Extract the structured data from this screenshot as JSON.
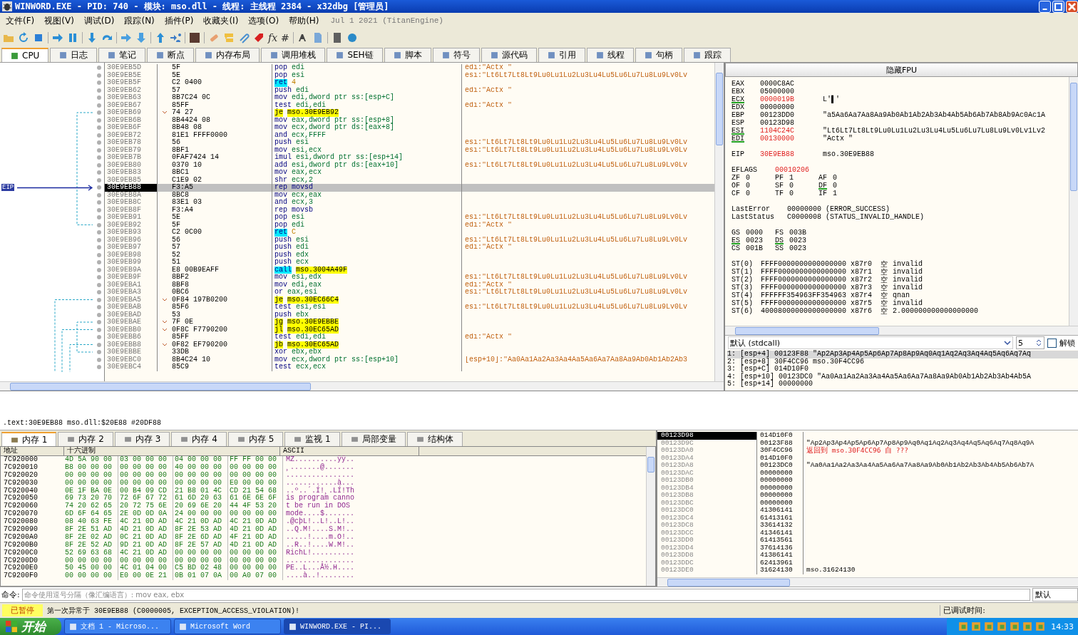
{
  "window": {
    "title": "WINWORD.EXE - PID: 740 - 模块: mso.dll - 线程: 主线程 2384 - x32dbg [管理员]"
  },
  "menu": [
    "文件(F)",
    "视图(V)",
    "调试(D)",
    "跟踪(N)",
    "插件(P)",
    "收藏夹(I)",
    "选项(O)",
    "帮助(H)"
  ],
  "build_info": "Jul 1 2021 (TitanEngine)",
  "toolbar": {
    "glyphs": [
      "fx",
      "#"
    ]
  },
  "tabs": [
    {
      "label": "CPU",
      "selected": true
    },
    {
      "label": "日志",
      "selected": false
    },
    {
      "label": "笔记",
      "selected": false
    },
    {
      "label": "断点",
      "selected": false
    },
    {
      "label": "内存布局",
      "selected": false
    },
    {
      "label": "调用堆栈",
      "selected": false
    },
    {
      "label": "SEH链",
      "selected": false
    },
    {
      "label": "脚本",
      "selected": false
    },
    {
      "label": "符号",
      "selected": false
    },
    {
      "label": "源代码",
      "selected": false
    },
    {
      "label": "引用",
      "selected": false
    },
    {
      "label": "线程",
      "selected": false
    },
    {
      "label": "句柄",
      "selected": false
    },
    {
      "label": "跟踪",
      "selected": false
    }
  ],
  "disassembly": {
    "eip_label": "EIP",
    "rows": [
      {
        "address": "30E9EB5D",
        "bytes": "5F",
        "branch": false,
        "mnemonic": "pop",
        "operands": "edi",
        "kind": "plain",
        "comment": "edi:\"Actx \"",
        "selected": false
      },
      {
        "address": "30E9EB5E",
        "bytes": "5E",
        "branch": false,
        "mnemonic": "pop",
        "operands": "esi",
        "kind": "plain",
        "comment": "esi:\"Lt6Lt7Lt8Lt9Lu0Lu1Lu2Lu3Lu4Lu5Lu6Lu7Lu8Lu9Lv0Lv",
        "selected": false
      },
      {
        "address": "30E9EB5F",
        "bytes": "C2 0400",
        "branch": false,
        "mnemonic": "ret",
        "operands": "4",
        "kind": "ret",
        "selected": false
      },
      {
        "address": "30E9EB62",
        "bytes": "57",
        "branch": false,
        "mnemonic": "push",
        "operands": "edi",
        "kind": "plain",
        "comment": "edi:\"Actx \"",
        "selected": false
      },
      {
        "address": "30E9EB63",
        "bytes": "8B7C24 0C",
        "branch": false,
        "mnemonic": "mov",
        "operands": "edi,dword ptr ss:[esp+C]",
        "kind": "plain",
        "selected": false
      },
      {
        "address": "30E9EB67",
        "bytes": "85FF",
        "branch": false,
        "mnemonic": "test",
        "operands": "edi,edi",
        "kind": "plain",
        "comment": "edi:\"Actx \"",
        "selected": false
      },
      {
        "address": "30E9EB69",
        "bytes": "74 27",
        "branch": true,
        "mnemonic": "je",
        "operands": "mso.30E9EB92",
        "kind": "jump",
        "selected": false
      },
      {
        "address": "30E9EB6B",
        "bytes": "8B4424 08",
        "branch": false,
        "mnemonic": "mov",
        "operands": "eax,dword ptr ss:[esp+8]",
        "kind": "plain",
        "selected": false
      },
      {
        "address": "30E9EB6F",
        "bytes": "8B48 08",
        "branch": false,
        "mnemonic": "mov",
        "operands": "ecx,dword ptr ds:[eax+8]",
        "kind": "plain",
        "selected": false
      },
      {
        "address": "30E9EB72",
        "bytes": "81E1 FFFF0000",
        "branch": false,
        "mnemonic": "and",
        "operands": "ecx,FFFF",
        "kind": "plain",
        "selected": false
      },
      {
        "address": "30E9EB78",
        "bytes": "56",
        "branch": false,
        "mnemonic": "push",
        "operands": "esi",
        "kind": "plain",
        "comment": "esi:\"Lt6Lt7Lt8Lt9Lu0Lu1Lu2Lu3Lu4Lu5Lu6Lu7Lu8Lu9Lv0Lv",
        "selected": false
      },
      {
        "address": "30E9EB79",
        "bytes": "8BF1",
        "branch": false,
        "mnemonic": "mov",
        "operands": "esi,ecx",
        "kind": "plain",
        "comment": "esi:\"Lt6Lt7Lt8Lt9Lu0Lu1Lu2Lu3Lu4Lu5Lu6Lu7Lu8Lu9Lv0Lv",
        "selected": false
      },
      {
        "address": "30E9EB7B",
        "bytes": "0FAF7424 14",
        "branch": false,
        "mnemonic": "imul",
        "operands": "esi,dword ptr ss:[esp+14]",
        "kind": "plain",
        "selected": false
      },
      {
        "address": "30E9EB80",
        "bytes": "0370 10",
        "branch": false,
        "mnemonic": "add",
        "operands": "esi,dword ptr ds:[eax+10]",
        "kind": "plain",
        "comment": "esi:\"Lt6Lt7Lt8Lt9Lu0Lu1Lu2Lu3Lu4Lu5Lu6Lu7Lu8Lu9Lv0Lv",
        "selected": false
      },
      {
        "address": "30E9EB83",
        "bytes": "8BC1",
        "branch": false,
        "mnemonic": "mov",
        "operands": "eax,ecx",
        "kind": "plain",
        "selected": false
      },
      {
        "address": "30E9EB85",
        "bytes": "C1E9 02",
        "branch": false,
        "mnemonic": "shr",
        "operands": "ecx,2",
        "kind": "plain",
        "selected": false
      },
      {
        "address": "30E9EB88",
        "bytes": "F3:A5",
        "branch": false,
        "mnemonic": "rep movsd",
        "kind": "plain",
        "selected": true
      },
      {
        "address": "30E9EB8A",
        "bytes": "8BC8",
        "branch": false,
        "mnemonic": "mov",
        "operands": "ecx,eax",
        "kind": "plain",
        "selected": false
      },
      {
        "address": "30E9EB8C",
        "bytes": "83E1 03",
        "branch": false,
        "mnemonic": "and",
        "operands": "ecx,3",
        "kind": "plain",
        "selected": false
      },
      {
        "address": "30E9EB8F",
        "bytes": "F3:A4",
        "branch": false,
        "mnemonic": "rep movsb",
        "kind": "plain",
        "selected": false
      },
      {
        "address": "30E9EB91",
        "bytes": "5E",
        "branch": false,
        "mnemonic": "pop",
        "operands": "esi",
        "kind": "plain",
        "comment": "esi:\"Lt6Lt7Lt8Lt9Lu0Lu1Lu2Lu3Lu4Lu5Lu6Lu7Lu8Lu9Lv0Lv",
        "selected": false
      },
      {
        "address": "30E9EB92",
        "bytes": "5F",
        "branch": false,
        "mnemonic": "pop",
        "operands": "edi",
        "kind": "plain",
        "comment": "edi:\"Actx \"",
        "selected": false
      },
      {
        "address": "30E9EB93",
        "bytes": "C2 0C00",
        "branch": false,
        "mnemonic": "ret",
        "operands": "C",
        "kind": "ret",
        "selected": false
      },
      {
        "address": "30E9EB96",
        "bytes": "56",
        "branch": false,
        "mnemonic": "push",
        "operands": "esi",
        "kind": "plain",
        "comment": "esi:\"Lt6Lt7Lt8Lt9Lu0Lu1Lu2Lu3Lu4Lu5Lu6Lu7Lu8Lu9Lv0Lv",
        "selected": false
      },
      {
        "address": "30E9EB97",
        "bytes": "57",
        "branch": false,
        "mnemonic": "push",
        "operands": "edi",
        "kind": "plain",
        "comment": "edi:\"Actx \"",
        "selected": false
      },
      {
        "address": "30E9EB98",
        "bytes": "52",
        "branch": false,
        "mnemonic": "push",
        "operands": "edx",
        "kind": "plain",
        "selected": false
      },
      {
        "address": "30E9EB99",
        "bytes": "51",
        "branch": false,
        "mnemonic": "push",
        "operands": "ecx",
        "kind": "plain",
        "selected": false
      },
      {
        "address": "30E9EB9A",
        "bytes": "E8 00B9EAFF",
        "branch": false,
        "mnemonic": "call",
        "operands": "mso.3004A49F",
        "kind": "call",
        "selected": false
      },
      {
        "address": "30E9EB9F",
        "bytes": "8BF2",
        "branch": false,
        "mnemonic": "mov",
        "operands": "esi,edx",
        "kind": "plain",
        "comment": "esi:\"Lt6Lt7Lt8Lt9Lu0Lu1Lu2Lu3Lu4Lu5Lu6Lu7Lu8Lu9Lv0Lv",
        "selected": false
      },
      {
        "address": "30E9EBA1",
        "bytes": "8BF8",
        "branch": false,
        "mnemonic": "mov",
        "operands": "edi,eax",
        "kind": "plain",
        "comment": "edi:\"Actx \"",
        "selected": false
      },
      {
        "address": "30E9EBA3",
        "bytes": "0BC6",
        "branch": false,
        "mnemonic": "or",
        "operands": "eax,esi",
        "kind": "plain",
        "comment": "esi:\"Lt6Lt7Lt8Lt9Lu0Lu1Lu2Lu3Lu4Lu5Lu6Lu7Lu8Lu9Lv0Lv",
        "selected": false
      },
      {
        "address": "30E9EBA5",
        "bytes": "0F84 197B0200",
        "branch": true,
        "mnemonic": "je",
        "operands": "mso.30EC66C4",
        "kind": "jump",
        "selected": false
      },
      {
        "address": "30E9EBAB",
        "bytes": "85F6",
        "branch": false,
        "mnemonic": "test",
        "operands": "esi,esi",
        "kind": "plain",
        "comment": "esi:\"Lt6Lt7Lt8Lt9Lu0Lu1Lu2Lu3Lu4Lu5Lu6Lu7Lu8Lu9Lv0Lv",
        "selected": false
      },
      {
        "address": "30E9EBAD",
        "bytes": "53",
        "branch": false,
        "mnemonic": "push",
        "operands": "ebx",
        "kind": "plain",
        "selected": false
      },
      {
        "address": "30E9EBAE",
        "bytes": "7F 0E",
        "branch": true,
        "mnemonic": "jg",
        "operands": "mso.30E9EBBE",
        "kind": "jump",
        "selected": false
      },
      {
        "address": "30E9EBB0",
        "bytes": "0F8C F7790200",
        "branch": true,
        "mnemonic": "jl",
        "operands": "mso.30EC65AD",
        "kind": "jump",
        "selected": false
      },
      {
        "address": "30E9EBB6",
        "bytes": "85FF",
        "branch": false,
        "mnemonic": "test",
        "operands": "edi,edi",
        "kind": "plain",
        "comment": "edi:\"Actx \"",
        "selected": false
      },
      {
        "address": "30E9EBB8",
        "bytes": "0F82 EF790200",
        "branch": true,
        "mnemonic": "jb",
        "operands": "mso.30EC65AD",
        "kind": "jump",
        "selected": false
      },
      {
        "address": "30E9EBBE",
        "bytes": "33DB",
        "branch": false,
        "mnemonic": "xor",
        "operands": "ebx,ebx",
        "kind": "plain",
        "selected": false
      },
      {
        "address": "30E9EBC0",
        "bytes": "8B4C24 10",
        "branch": false,
        "mnemonic": "mov",
        "operands": "ecx,dword ptr ss:[esp+10]",
        "kind": "plain",
        "comment": "[esp+10]:\"Aa0Aa1Aa2Aa3Aa4Aa5Aa6Aa7Aa8Aa9Ab0Ab1Ab2Ab3",
        "selected": false
      },
      {
        "address": "30E9EBC4",
        "bytes": "85C9",
        "branch": false,
        "mnemonic": "test",
        "operands": "ecx,ecx",
        "kind": "plain",
        "selected": false
      }
    ]
  },
  "info_line": ".text:30E9EB88 mso.dll:$20E88 #20DF88",
  "registers_panel": {
    "toggle_button": "隐藏FPU",
    "gp_registers": [
      {
        "name": "EAX",
        "value": "0000C8AC",
        "changed": false,
        "marked": false
      },
      {
        "name": "EBX",
        "value": "05000000",
        "changed": false,
        "marked": false
      },
      {
        "name": "ECX",
        "value": "0000019B",
        "changed": true,
        "marked": true,
        "comment": "L'▌'"
      },
      {
        "name": "EDX",
        "value": "00000000",
        "changed": false,
        "marked": false
      },
      {
        "name": "EBP",
        "value": "00123DD0",
        "changed": false,
        "marked": false,
        "comment": "\"a5Aa6Aa7Aa8Aa9Ab0Ab1Ab2Ab3Ab4Ab5Ab6Ab7Ab8Ab9Ac0Ac1A"
      },
      {
        "name": "ESP",
        "value": "00123D98",
        "changed": false,
        "marked": false
      },
      {
        "name": "ESI",
        "value": "1104C24C",
        "changed": true,
        "marked": true,
        "comment": "\"Lt6Lt7Lt8Lt9Lu0Lu1Lu2Lu3Lu4Lu5Lu6Lu7Lu8Lu9Lv0Lv1Lv2"
      },
      {
        "name": "EDI",
        "value": "00130000",
        "changed": true,
        "marked": true,
        "comment": "\"Actx \""
      }
    ],
    "ip_register": {
      "name": "EIP",
      "value": "30E9EB88",
      "changed": true,
      "comment": "mso.30E9EB88"
    },
    "eflags": {
      "name": "EFLAGS",
      "value": "00010206",
      "changed": true
    },
    "flags": [
      {
        "name": "ZF",
        "value": "0",
        "marked": false
      },
      {
        "name": "PF",
        "value": "1",
        "marked": false
      },
      {
        "name": "AF",
        "value": "0",
        "marked": false
      },
      {
        "name": "OF",
        "value": "0",
        "marked": false
      },
      {
        "name": "SF",
        "value": "0",
        "marked": false
      },
      {
        "name": "DF",
        "value": "0",
        "marked": true
      },
      {
        "name": "CF",
        "value": "0",
        "marked": false
      },
      {
        "name": "TF",
        "value": "0",
        "marked": false
      },
      {
        "name": "IF",
        "value": "1",
        "marked": false
      }
    ],
    "last_status": [
      {
        "label": "LastError",
        "value": "00000000 (ERROR_SUCCESS)"
      },
      {
        "label": "LastStatus",
        "value": "C0000008 (STATUS_INVALID_HANDLE)"
      }
    ],
    "segments": [
      {
        "name": "GS",
        "value": "0000",
        "marked": false
      },
      {
        "name": "FS",
        "value": "003B",
        "marked": false
      },
      {
        "name": "ES",
        "value": "0023",
        "marked": true
      },
      {
        "name": "DS",
        "value": "0023",
        "marked": true
      },
      {
        "name": "CS",
        "value": "001B",
        "marked": false
      },
      {
        "name": "SS",
        "value": "0023",
        "marked": false
      }
    ],
    "fpu": [
      {
        "name": "ST(0)",
        "value": "FFFF0000000000000000",
        "register": "x87r0",
        "tag": "空",
        "description": "invalid"
      },
      {
        "name": "ST(1)",
        "value": "FFFF0000000000000000",
        "register": "x87r1",
        "tag": "空",
        "description": "invalid"
      },
      {
        "name": "ST(2)",
        "value": "FFFF0000000000000000",
        "register": "x87r2",
        "tag": "空",
        "description": "invalid"
      },
      {
        "name": "ST(3)",
        "value": "FFFF0000000000000000",
        "register": "x87r3",
        "tag": "空",
        "description": "invalid"
      },
      {
        "name": "ST(4)",
        "value": "FFFFFF354963FF354963",
        "register": "x87r4",
        "tag": "空",
        "description": "qnan"
      },
      {
        "name": "ST(5)",
        "value": "FFFF0000000000000000",
        "register": "x87r5",
        "tag": "空",
        "description": "invalid"
      },
      {
        "name": "ST(6)",
        "value": "40008000000000000000",
        "register": "x87r6",
        "tag": "空",
        "description": "2.000000000000000000"
      }
    ]
  },
  "call_args": {
    "convention": "默认 (stdcall)",
    "count": "5",
    "unlock": {
      "label": "解锁",
      "checked": false
    },
    "lines": [
      {
        "text": "1: [esp+4] 00123F88 \"Ap2Ap3Ap4Ap5Ap6Ap7Ap8Ap9Aq0Aq1Aq2Aq3Aq4Aq5Aq6Aq7Aq",
        "selected": true
      },
      {
        "text": "2: [esp+8] 30F4CC96 mso.30F4CC96",
        "selected": false
      },
      {
        "text": "3: [esp+C] 014D10F0",
        "selected": false
      },
      {
        "text": "4: [esp+10] 00123DC0 \"Aa0Aa1Aa2Aa3Aa4Aa5Aa6Aa7Aa8Aa9Ab0Ab1Ab2Ab3Ab4Ab5A",
        "selected": false
      },
      {
        "text": "5: [esp+14] 00000000",
        "selected": false
      }
    ]
  },
  "memory_tabs": [
    {
      "label": "内存 1",
      "selected": true
    },
    {
      "label": "内存 2",
      "selected": false
    },
    {
      "label": "内存 3",
      "selected": false
    },
    {
      "label": "内存 4",
      "selected": false
    },
    {
      "label": "内存 5",
      "selected": false
    },
    {
      "label": "监视 1",
      "selected": false
    },
    {
      "label": "局部变量",
      "selected": false
    },
    {
      "label": "结构体",
      "selected": false
    }
  ],
  "hex_dump": {
    "columns": [
      "地址",
      "十六进制",
      "ASCII"
    ],
    "rows": [
      {
        "address": "7C920000",
        "bytes": "4D 5A 90 00 03 00 00 00 04 00 00 00 FF FF 00 00",
        "ascii": "MZ..........ÿÿ.."
      },
      {
        "address": "7C920010",
        "bytes": "B8 00 00 00 00 00 00 00 40 00 00 00 00 00 00 00",
        "ascii": "¸.......@......."
      },
      {
        "address": "7C920020",
        "bytes": "00 00 00 00 00 00 00 00 00 00 00 00 00 00 00 00",
        "ascii": "................"
      },
      {
        "address": "7C920030",
        "bytes": "00 00 00 00 00 00 00 00 00 00 00 00 E0 00 00 00",
        "ascii": "............à..."
      },
      {
        "address": "7C920040",
        "bytes": "0E 1F BA 0E 00 B4 09 CD 21 B8 01 4C CD 21 54 68",
        "ascii": "..º..´.Í!¸.LÍ!Th"
      },
      {
        "address": "7C920050",
        "bytes": "69 73 20 70 72 6F 67 72 61 6D 20 63 61 6E 6E 6F",
        "ascii": "is program canno"
      },
      {
        "address": "7C920060",
        "bytes": "74 20 62 65 20 72 75 6E 20 69 6E 20 44 4F 53 20",
        "ascii": "t be run in DOS "
      },
      {
        "address": "7C920070",
        "bytes": "6D 6F 64 65 2E 0D 0D 0A 24 00 00 00 00 00 00 00",
        "ascii": "mode....$......."
      },
      {
        "address": "7C920080",
        "bytes": "08 40 63 FE 4C 21 0D AD 4C 21 0D AD 4C 21 0D AD",
        "ascii": ".@cþL!..L!..L!.."
      },
      {
        "address": "7C920090",
        "bytes": "8F 2E 51 AD 4D 21 0D AD 8F 2E 53 AD 4D 21 0D AD",
        "ascii": "..Q.M!....S.M!.."
      },
      {
        "address": "7C9200A0",
        "bytes": "8F 2E 02 AD 0C 21 0D AD 8F 2E 6D AD 4F 21 0D AD",
        "ascii": ".....!....m.O!.."
      },
      {
        "address": "7C9200B0",
        "bytes": "8F 2E 52 AD 9D 21 0D AD 8F 2E 57 AD 4D 21 0D AD",
        "ascii": "..R..!....W.M!.."
      },
      {
        "address": "7C9200C0",
        "bytes": "52 69 63 68 4C 21 0D AD 00 00 00 00 00 00 00 00",
        "ascii": "RichL!.........."
      },
      {
        "address": "7C9200D0",
        "bytes": "00 00 00 00 00 00 00 00 00 00 00 00 00 00 00 00",
        "ascii": "................"
      },
      {
        "address": "7C9200E0",
        "bytes": "50 45 00 00 4C 01 04 00 C5 BD 02 48 00 00 00 00",
        "ascii": "PE..L...Å½.H...."
      },
      {
        "address": "7C9200F0",
        "bytes": "00 00 00 00 E0 00 0E 21 0B 01 07 0A 00 A0 07 00",
        "ascii": "....à..!........"
      }
    ]
  },
  "stack": {
    "rows": [
      {
        "address": "00123D98",
        "value": "014D10F0",
        "kind": "plain",
        "selected": true
      },
      {
        "address": "00123D9C",
        "value": "00123F88",
        "kind": "plain",
        "comment": "\"Ap2Ap3Ap4Ap5Ap6Ap7Ap8Ap9Aq0Aq1Aq2Aq3Aq4Aq5Aq6Aq7Aq8Aq9A",
        "selected": false
      },
      {
        "address": "00123DA0",
        "value": "30F4CC96",
        "kind": "return",
        "comment": "返回到 mso.30F4CC96 自 ???",
        "selected": false
      },
      {
        "address": "00123DA4",
        "value": "014D10F0",
        "kind": "plain",
        "selected": false
      },
      {
        "address": "00123DA8",
        "value": "00123DC0",
        "kind": "plain",
        "comment": "\"Aa0Aa1Aa2Aa3Aa4Aa5Aa6Aa7Aa8Aa9Ab0Ab1Ab2Ab3Ab4Ab5Ab6Ab7A",
        "selected": false
      },
      {
        "address": "00123DAC",
        "value": "00000000",
        "kind": "plain",
        "selected": false
      },
      {
        "address": "00123DB0",
        "value": "00000000",
        "kind": "plain",
        "selected": false
      },
      {
        "address": "00123DB4",
        "value": "00000000",
        "kind": "plain",
        "selected": false
      },
      {
        "address": "00123DB8",
        "value": "00000000",
        "kind": "plain",
        "selected": false
      },
      {
        "address": "00123DBC",
        "value": "00000000",
        "kind": "plain",
        "selected": false
      },
      {
        "address": "00123DC0",
        "value": "41306141",
        "kind": "plain",
        "selected": false
      },
      {
        "address": "00123DC4",
        "value": "61413161",
        "kind": "plain",
        "selected": false
      },
      {
        "address": "00123DC8",
        "value": "33614132",
        "kind": "plain",
        "selected": false
      },
      {
        "address": "00123DCC",
        "value": "41346141",
        "kind": "plain",
        "selected": false
      },
      {
        "address": "00123DD0",
        "value": "61413561",
        "kind": "plain",
        "selected": false
      },
      {
        "address": "00123DD4",
        "value": "37614136",
        "kind": "plain",
        "selected": false
      },
      {
        "address": "00123DD8",
        "value": "41386141",
        "kind": "plain",
        "selected": false
      },
      {
        "address": "00123DDC",
        "value": "62413961",
        "kind": "plain",
        "selected": false
      },
      {
        "address": "00123DE0",
        "value": "31624130",
        "kind": "plain",
        "comment": "mso.31624130",
        "selected": false
      }
    ]
  },
  "command": {
    "label": "命令:",
    "placeholder": "命令使用逗号分隔（像汇编语言）: mov eax, ebx",
    "mode": "默认"
  },
  "status": {
    "state": "已暂停",
    "message": "第一次异常于 30E9EB88 (C0000005, EXCEPTION_ACCESS_VIOLATION)!",
    "elapsed_label": "已调试时间:"
  },
  "taskbar": {
    "start": "开始",
    "tasks": [
      {
        "label": "文档 1 - Microso...",
        "selected": false
      },
      {
        "label": "Microsoft Word",
        "selected": false
      },
      {
        "label": "WINWORD.EXE - PI...",
        "selected": true
      }
    ],
    "clock": "14:33"
  }
}
